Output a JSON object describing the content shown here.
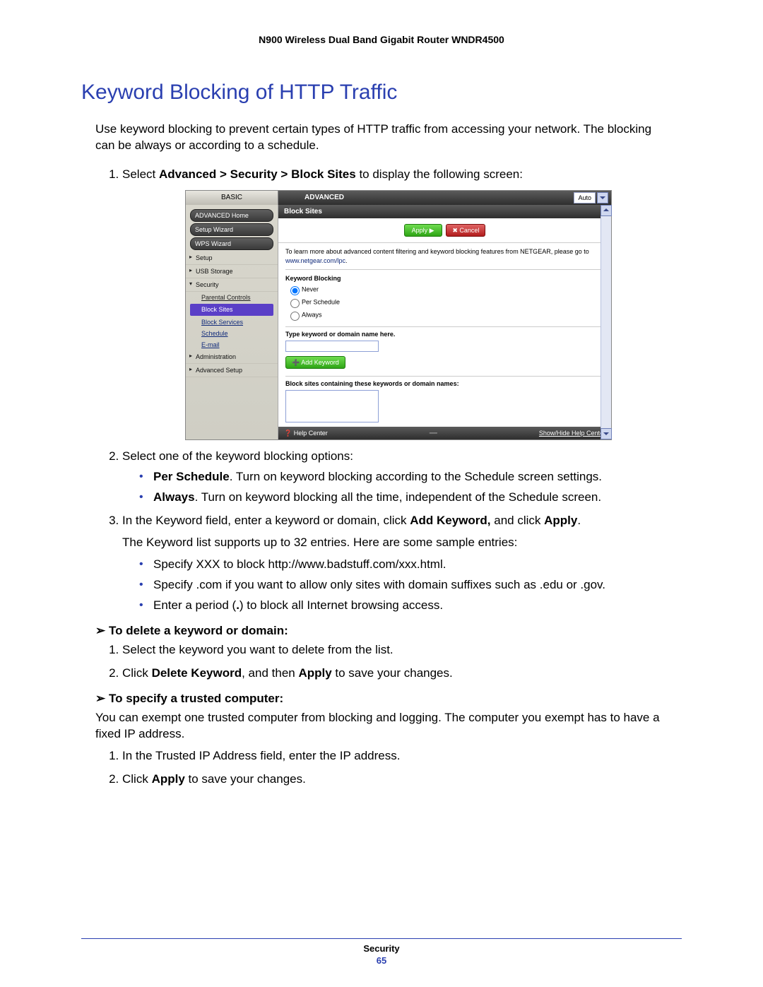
{
  "header": {
    "product": "N900 Wireless Dual Band Gigabit Router WNDR4500"
  },
  "title": "Keyword Blocking of HTTP Traffic",
  "intro": "Use keyword blocking to prevent certain types of HTTP traffic from accessing your network. The blocking can be always or according to a schedule.",
  "steps": {
    "s1_pre": "Select ",
    "s1_bold": "Advanced > Security > Block Sites",
    "s1_post": " to display the following screen:",
    "s2": "Select one of the keyword blocking options:",
    "s2a_bold": "Per Schedule",
    "s2a_rest": ". Turn on keyword blocking according to the Schedule screen settings.",
    "s2b_bold": "Always",
    "s2b_rest": ". Turn on keyword blocking all the time, independent of the Schedule screen.",
    "s3_pre": "In the Keyword field, enter a keyword or domain, click ",
    "s3_b1": "Add Keyword,",
    "s3_mid": " and click ",
    "s3_b2": "Apply",
    "s3_plain": "The Keyword list supports up to 32 entries. Here are some sample entries:",
    "s3a": "Specify XXX to block http://www.badstuff.com/xxx.html.",
    "s3b": "Specify .com if you want to allow only sites with domain suffixes such as .edu or .gov.",
    "s3c_pre": "Enter a period (",
    "s3c_bold": ".",
    "s3c_post": ") to block all Internet browsing access."
  },
  "proc1": {
    "title": "To delete a keyword or domain:",
    "i1": "Select the keyword you want to delete from the list.",
    "i2_pre": "Click ",
    "i2_b1": "Delete Keyword",
    "i2_mid": ", and then ",
    "i2_b2": "Apply",
    "i2_post": " to save your changes."
  },
  "proc2": {
    "title": "To specify a trusted computer:",
    "intro": "You can exempt one trusted computer from blocking and logging. The computer you exempt has to have a fixed IP address.",
    "i1": "In the Trusted IP Address field, enter the IP address.",
    "i2_pre": "Click ",
    "i2_b": "Apply",
    "i2_post": " to save your changes."
  },
  "footer": {
    "chapter": "Security",
    "page": "65"
  },
  "shot": {
    "tab_basic": "BASIC",
    "tab_advanced": "ADVANCED",
    "auto": "Auto",
    "side": {
      "advhome": "ADVANCED Home",
      "setupwiz": "Setup Wizard",
      "wpswiz": "WPS Wizard",
      "setup": "Setup",
      "usb": "USB Storage",
      "security": "Security",
      "parental": "Parental Controls",
      "block_sites": "Block Sites",
      "block_services": "Block Services",
      "schedule": "Schedule",
      "email": "E-mail",
      "admin": "Administration",
      "advsetup": "Advanced Setup"
    },
    "panel": {
      "title": "Block Sites",
      "apply": "Apply ▶",
      "cancel": "✖ Cancel",
      "note_pre": "To learn more about advanced content filtering and keyword blocking features from NETGEAR, please go to ",
      "note_link": "www.netgear.com/lpc",
      "kb_title": "Keyword Blocking",
      "r_never": "Never",
      "r_sched": "Per Schedule",
      "r_always": "Always",
      "type_hdr": "Type keyword or domain name here.",
      "add_btn": "➕ Add Keyword",
      "list_hdr": "Block sites containing these keywords or domain names:",
      "help": "❓ Help Center",
      "showhide": "Show/Hide Help Center"
    }
  }
}
